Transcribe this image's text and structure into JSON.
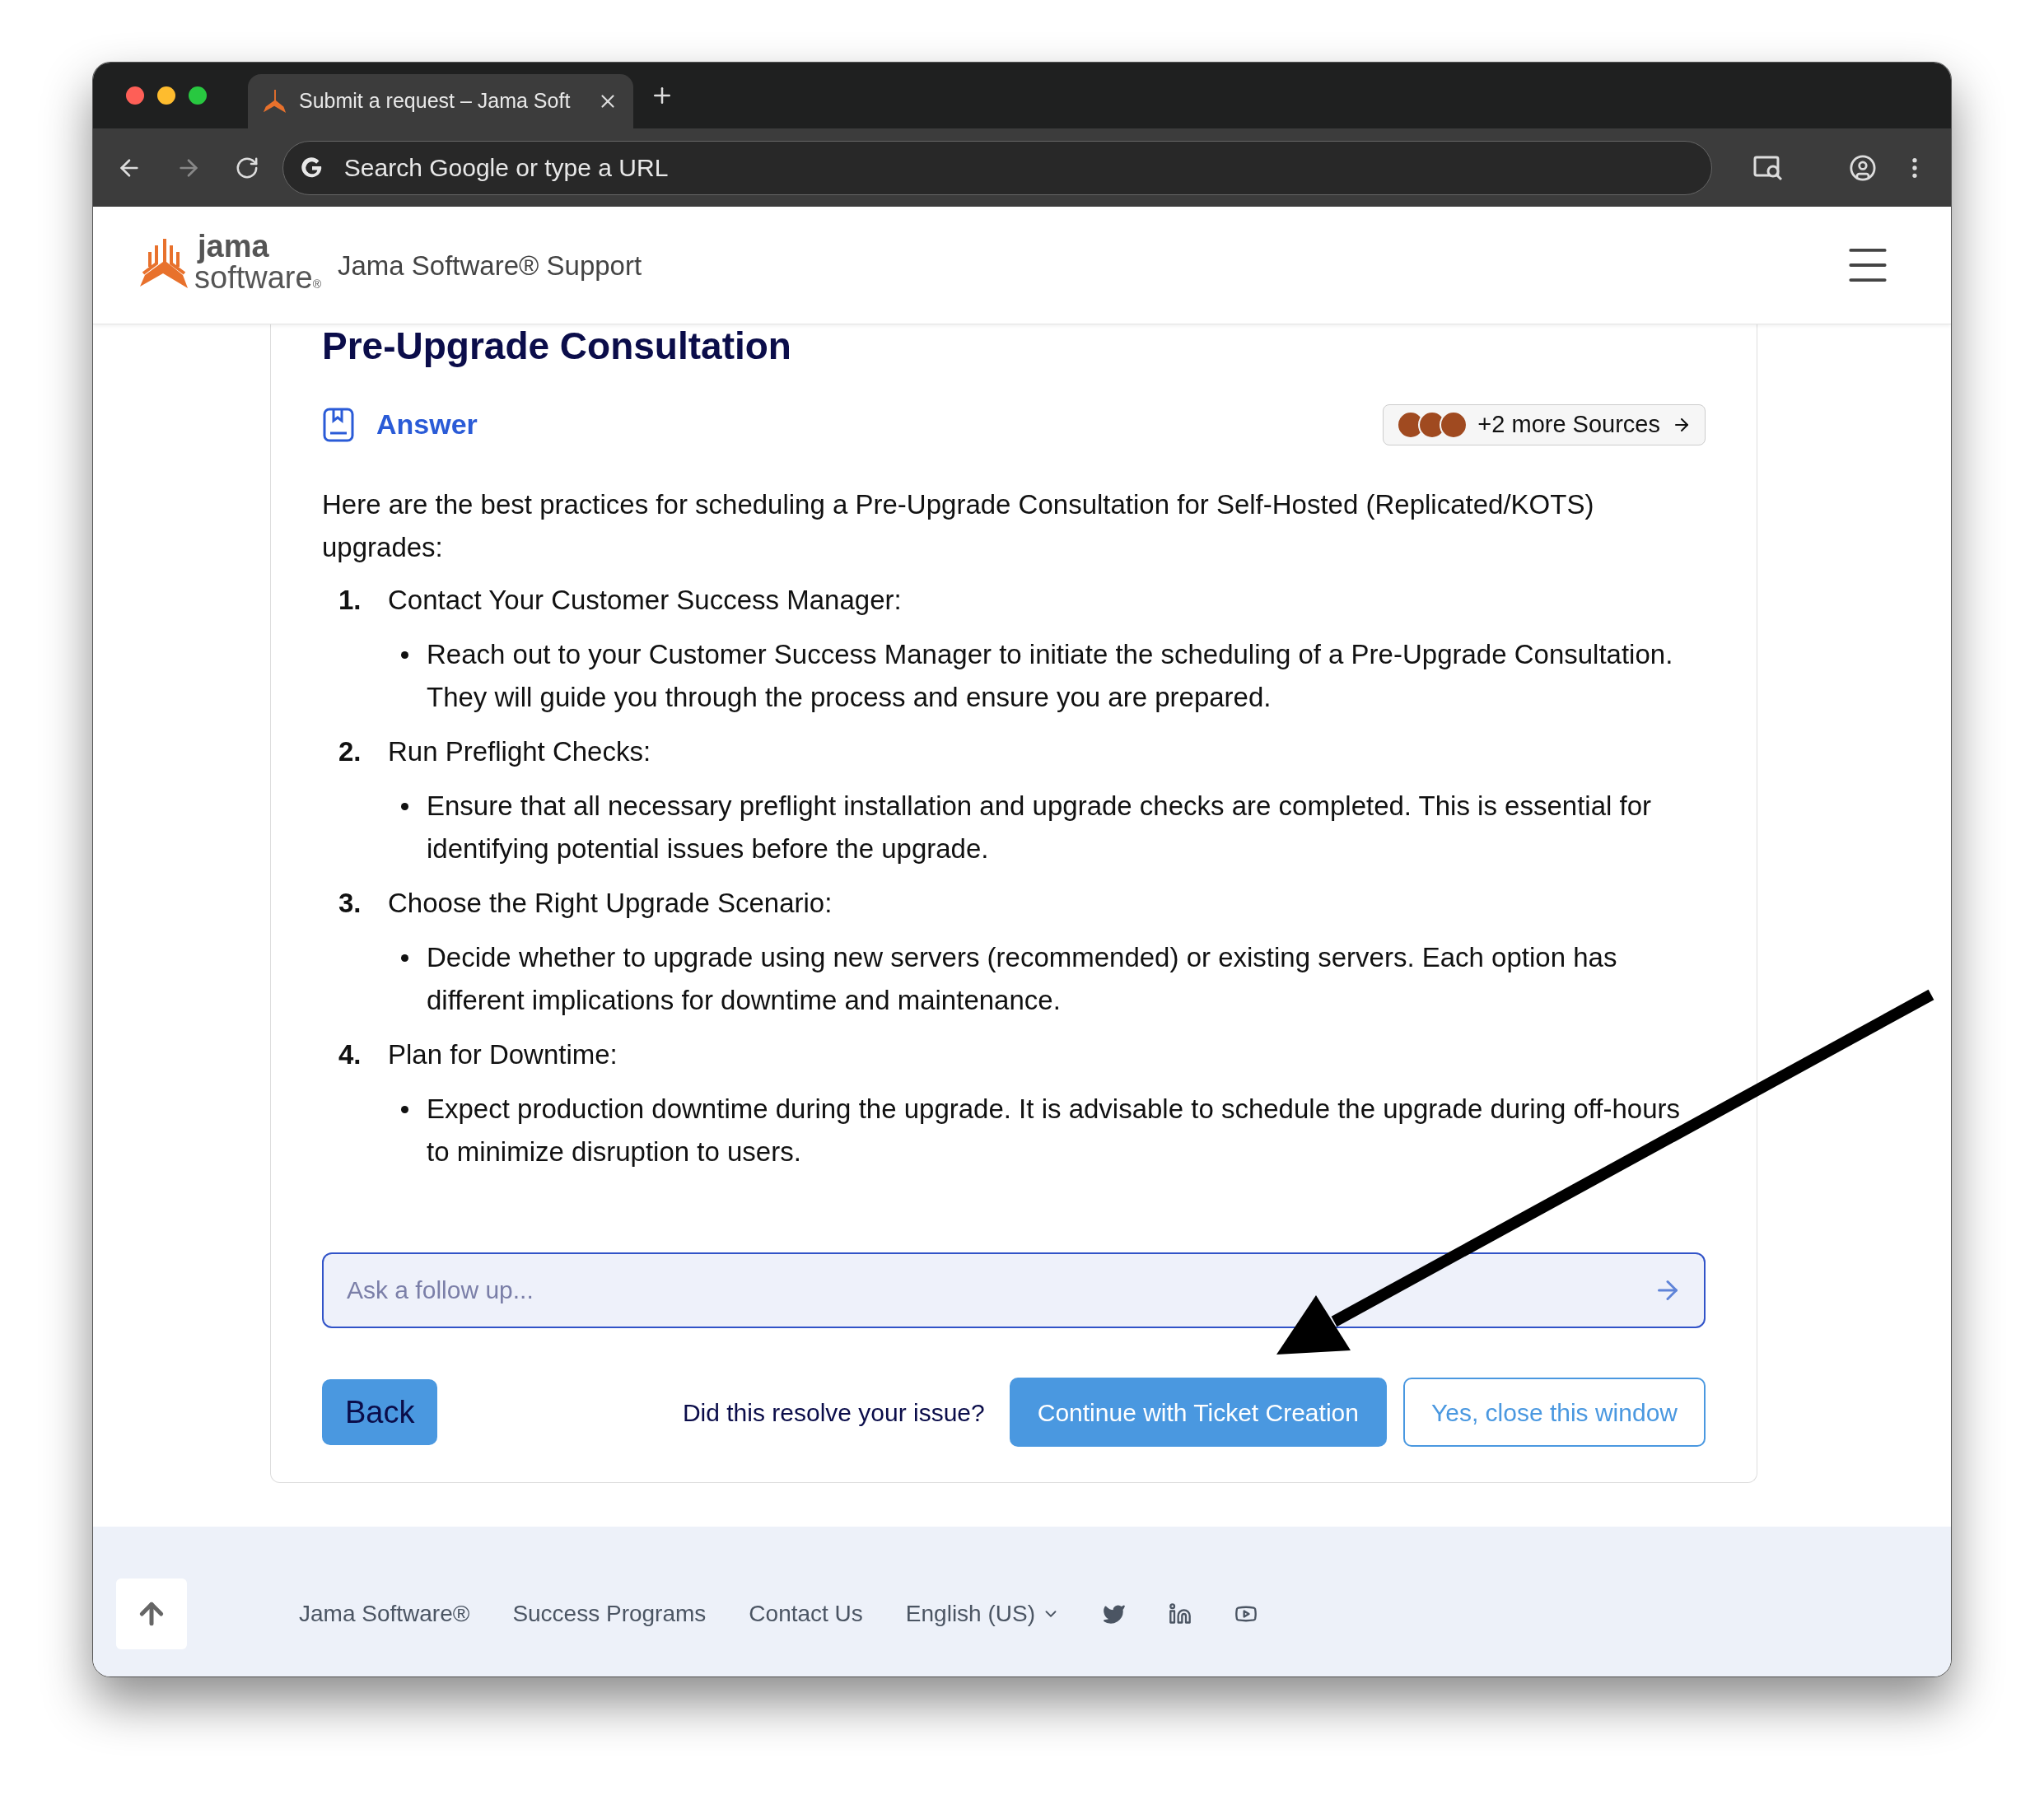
{
  "browser": {
    "tab_title": "Submit a request – Jama Soft",
    "address_placeholder": "Search Google or type a URL"
  },
  "header": {
    "logo_lines": [
      "jama",
      "software"
    ],
    "logo_mark": "®",
    "site_title": "Jama Software® Support"
  },
  "article": {
    "title": "Pre-Upgrade Consultation",
    "answer_label": "Answer",
    "sources_button": "+2 more Sources",
    "intro": "Here are the best practices for scheduling a Pre-Upgrade Consultation for Self-Hosted (Replicated/KOTS) upgrades:",
    "steps": [
      {
        "number": "1.",
        "title": "Contact Your Customer Success Manager:",
        "bullets": [
          "Reach out to your Customer Success Manager to initiate the scheduling of a Pre-Upgrade Consultation. They will guide you through the process and ensure you are prepared."
        ]
      },
      {
        "number": "2.",
        "title": "Run Preflight Checks:",
        "bullets": [
          "Ensure that all necessary preflight installation and upgrade checks are completed. This is essential for identifying potential issues before the upgrade."
        ]
      },
      {
        "number": "3.",
        "title": "Choose the Right Upgrade Scenario:",
        "bullets": [
          "Decide whether to upgrade using new servers (recommended) or existing servers. Each option has different implications for downtime and maintenance."
        ]
      },
      {
        "number": "4.",
        "title": "Plan for Downtime:",
        "bullets": [
          "Expect production downtime during the upgrade. It is advisable to schedule the upgrade during off-hours to minimize disruption to users."
        ]
      }
    ]
  },
  "followup": {
    "placeholder": "Ask a follow up..."
  },
  "actions": {
    "back": "Back",
    "question": "Did this resolve your issue?",
    "continue": "Continue with Ticket Creation",
    "close": "Yes, close this window"
  },
  "footer": {
    "links": [
      "Jama Software®",
      "Success Programs",
      "Contact Us"
    ],
    "language": "English (US)"
  }
}
